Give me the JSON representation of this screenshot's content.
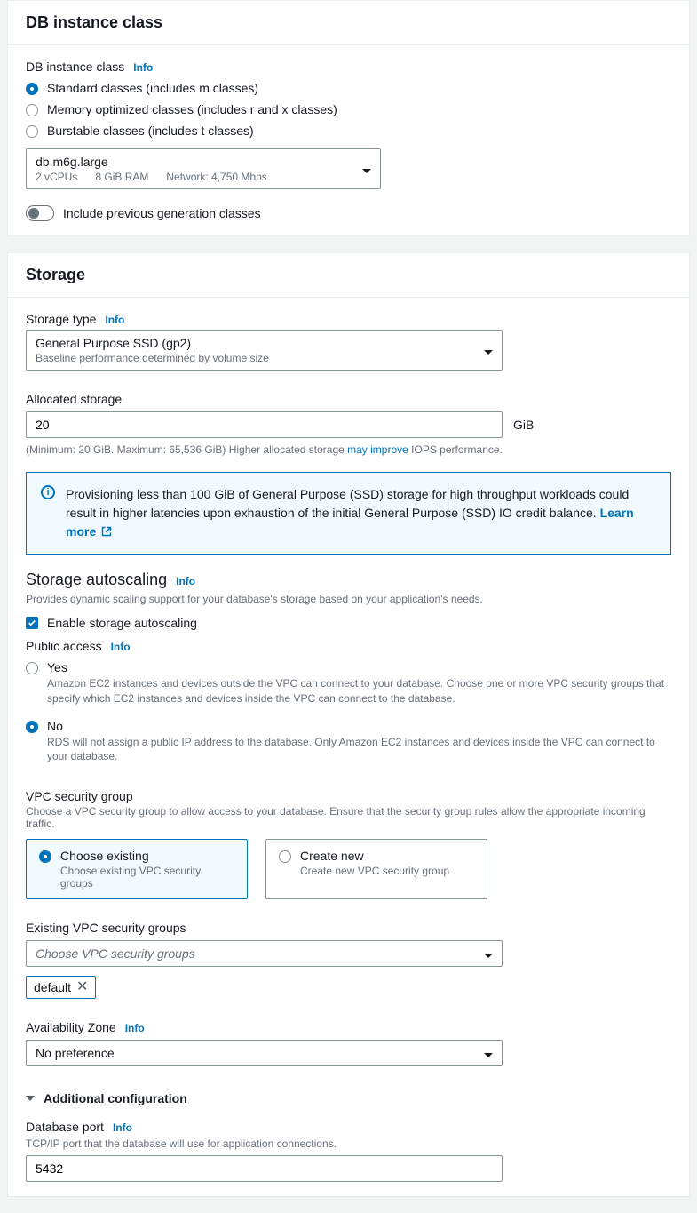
{
  "db_class": {
    "header": "DB instance class",
    "label": "DB instance class",
    "info": "Info",
    "options": {
      "standard": "Standard classes (includes m classes)",
      "memory": "Memory optimized classes (includes r and x classes)",
      "burstable": "Burstable classes (includes t classes)"
    },
    "select": {
      "primary": "db.m6g.large",
      "secondary": "2 vCPUs      8 GiB RAM      Network: 4,750 Mbps"
    },
    "toggle_label": "Include previous generation classes"
  },
  "storage": {
    "header": "Storage",
    "type_label": "Storage type",
    "info": "Info",
    "type_select": {
      "primary": "General Purpose SSD (gp2)",
      "secondary": "Baseline performance determined by volume size"
    },
    "allocated_label": "Allocated storage",
    "allocated_value": "20",
    "allocated_unit": "GiB",
    "allocated_helper_pre": "(Minimum: 20 GiB. Maximum: 65,536 GiB) Higher allocated storage ",
    "allocated_helper_link": "may improve",
    "allocated_helper_post": " IOPS performance.",
    "alert_text": "Provisioning less than 100 GiB of General Purpose (SSD) storage for high throughput workloads could result in higher latencies upon exhaustion of the initial General Purpose (SSD) IO credit balance. ",
    "alert_link": "Learn more",
    "autoscaling_title": "Storage autoscaling",
    "autoscaling_desc": "Provides dynamic scaling support for your database's storage based on your application's needs.",
    "autoscaling_checkbox": "Enable storage autoscaling",
    "public_access_label": "Public access",
    "public_yes": "Yes",
    "public_yes_desc": "Amazon EC2 instances and devices outside the VPC can connect to your database. Choose one or more VPC security groups that specify which EC2 instances and devices inside the VPC can connect to the database.",
    "public_no": "No",
    "public_no_desc": "RDS will not assign a public IP address to the database. Only Amazon EC2 instances and devices inside the VPC can connect to your database.",
    "vpc_sg_label": "VPC security group",
    "vpc_sg_desc": "Choose a VPC security group to allow access to your database. Ensure that the security group rules allow the appropriate incoming traffic.",
    "vpc_existing_label": "Choose existing",
    "vpc_existing_desc": "Choose existing VPC security groups",
    "vpc_create_label": "Create new",
    "vpc_create_desc": "Create new VPC security group",
    "existing_sg_label": "Existing VPC security groups",
    "existing_sg_placeholder": "Choose VPC security groups",
    "chip_default": "default",
    "az_label": "Availability Zone",
    "az_value": "No preference",
    "additional_config": "Additional configuration",
    "db_port_label": "Database port",
    "db_port_desc": "TCP/IP port that the database will use for application connections.",
    "db_port_value": "5432"
  }
}
